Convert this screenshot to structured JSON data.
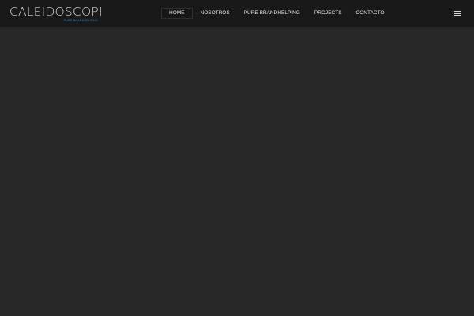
{
  "header": {
    "logo": {
      "wordmark": "CALEIDOSCOPI",
      "tagline": "PURE BRANDHELPING"
    },
    "nav": {
      "items": [
        {
          "label": "HOME",
          "active": true
        },
        {
          "label": "NOSOTROS",
          "active": false
        },
        {
          "label": "PURE BRANDHELPING",
          "active": false
        },
        {
          "label": "PROJECTS",
          "active": false
        },
        {
          "label": "CONTACTO",
          "active": false
        }
      ]
    },
    "menu_toggle_icon": "hamburger-menu-icon"
  },
  "colors": {
    "header_bg": "#191919",
    "page_bg": "#282828",
    "nav_text": "#e2e2e2",
    "logo_text": "#d6d6d6",
    "tagline_accent": "#2f7fc4"
  }
}
